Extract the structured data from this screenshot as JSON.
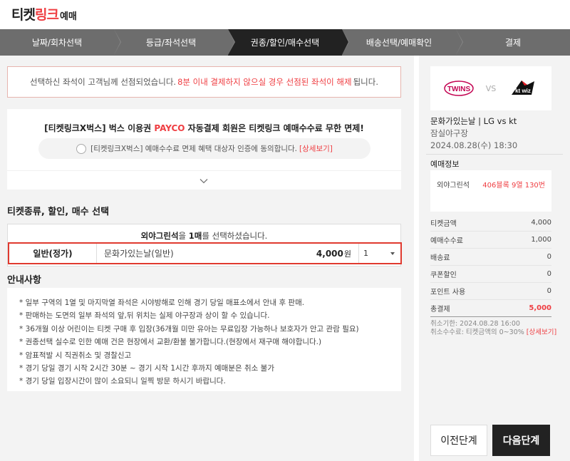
{
  "logo": {
    "part1": "티켓",
    "part2": "링크",
    "part3": "예매"
  },
  "steps": [
    {
      "label": "날짜/회차선택"
    },
    {
      "label": "등급/좌석선택"
    },
    {
      "label": "권종/할인/매수선택"
    },
    {
      "label": "배송선택/예매확인"
    },
    {
      "label": "결제"
    }
  ],
  "notice": {
    "prefix": "선택하신 좌석이 고객님께 선점되었습니다.",
    "highlight": "8분 이내 결제하지 않으실 경우 선점된 좌석이 해제",
    "suffix": "됩니다."
  },
  "promo": {
    "title_pre": "[티켓링크X벅스] 벅스 이용권 ",
    "title_payco": "PAYCO",
    "title_post": " 자동결제 회원은 티켓링크 예매수수료 무한 면제!",
    "agree_text": "[티켓링크X벅스] 예매수수료 면제 혜택 대상자 인증에 동의합니다.",
    "detail_link": "[상세보기]"
  },
  "ticket_section": {
    "title": "티켓종류, 할인, 매수 선택",
    "head_seat": "외야그린석",
    "head_mid": "을 ",
    "head_count": "1매",
    "head_end": "를 선택하셨습니다.",
    "row": {
      "type": "일반(정가)",
      "name": "문화가있는날(일반)",
      "price": "4,000",
      "unit": "원",
      "quantity": "1"
    }
  },
  "guide": {
    "title": "안내사항",
    "items": [
      "* 일부 구역의 1열 및 마지막열 좌석은 시야방해로 인해 경기 당일 매표소에서 안내 후 판매.",
      "* 판매하는 도면의 일부 좌석의 앞,뒤 위치는 실제 야구장과 상이 할 수 있습니다.",
      "* 36개월 이상 어린이는 티켓 구매 후 입장(36개월 미만 유아는 무료입장 가능하나 보호자가 안고 관람 필요)",
      "* 권종선택 실수로 인한 예매 건은 현장에서 교환/환불 불가합니다.(현장에서 재구매 해야합니다.)",
      "* 암표적발 시 직권취소 및 경찰신고",
      "* 경기 당일 경기 시작 2시간 30분 ~ 경기 시작 1시간 후까지 예매분은 취소 불가",
      "* 경기 당일 입장시간이 많이 소요되니 일찍 방문 하시기 바랍니다."
    ]
  },
  "summary": {
    "home_logo": "TWINS",
    "vs": "VS",
    "away_logo": "kt wiz",
    "game_title": "문화가있는날 | LG vs kt",
    "venue": "잠실야구장",
    "datetime": "2024.08.28(수) 18:30",
    "reserve_title": "예매정보",
    "seat_label": "외야그린석",
    "seat_value": "406블록 9열 130번",
    "rows": [
      {
        "label": "티켓금액",
        "value": "4,000"
      },
      {
        "label": "예매수수료",
        "value": "1,000"
      },
      {
        "label": "배송료",
        "value": "0"
      },
      {
        "label": "쿠폰할인",
        "value": "0"
      },
      {
        "label": "포인트 사용",
        "value": "0"
      }
    ],
    "total_label": "총결제",
    "total_value": "5,000",
    "cancel_deadline": "취소기한: 2024.08.28 16:00",
    "cancel_fee": "취소수수료: 티켓금액의 0~30%",
    "cancel_detail": "[상세보기]"
  },
  "buttons": {
    "prev": "이전단계",
    "next": "다음단계"
  },
  "colors": {
    "accent": "#ef3e42",
    "dark": "#222222",
    "step_bg": "#6d6d6d"
  }
}
